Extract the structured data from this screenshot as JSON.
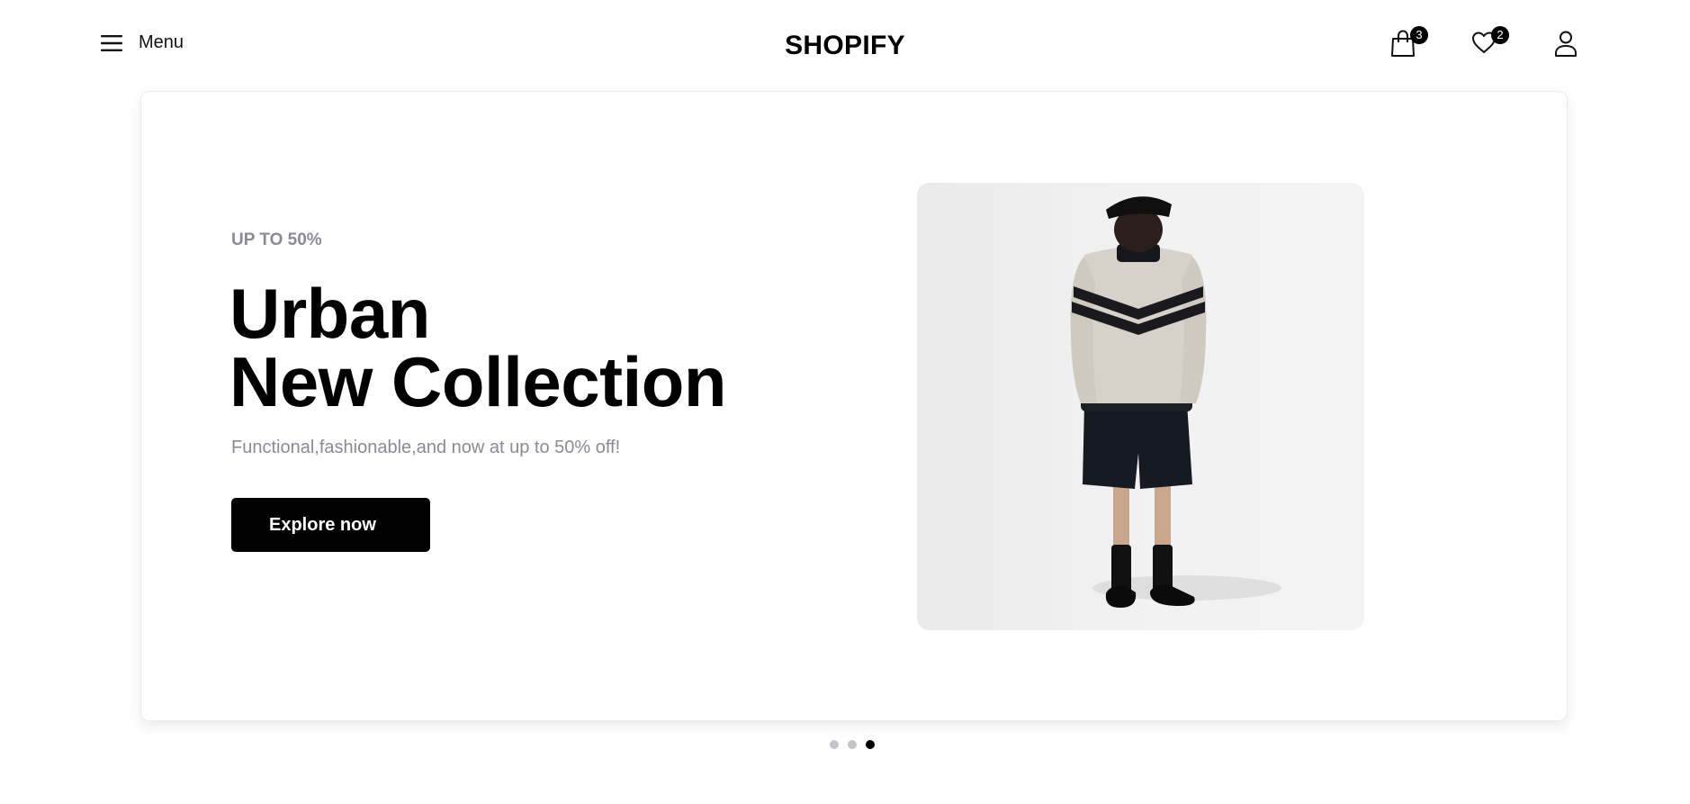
{
  "header": {
    "menu_label": "Menu",
    "brand": "SHOPIFY",
    "cart_count": "3",
    "wishlist_count": "2"
  },
  "hero": {
    "eyebrow": "UP TO 50%",
    "title_line1": "Urban",
    "title_line2": "New Collection",
    "subtitle": "Functional,fashionable,and now at up to 50% off!",
    "cta_label": "Explore now"
  },
  "carousel": {
    "slide_count": 3,
    "active_index": 2
  },
  "icons": {
    "menu": "hamburger-icon",
    "cart": "shopping-bag-icon",
    "wishlist": "heart-icon",
    "account": "user-icon"
  },
  "colors": {
    "accent": "#000000",
    "muted_text": "#8a8a98",
    "dot_inactive": "#c4c4cc",
    "badge_bg": "#000000"
  }
}
